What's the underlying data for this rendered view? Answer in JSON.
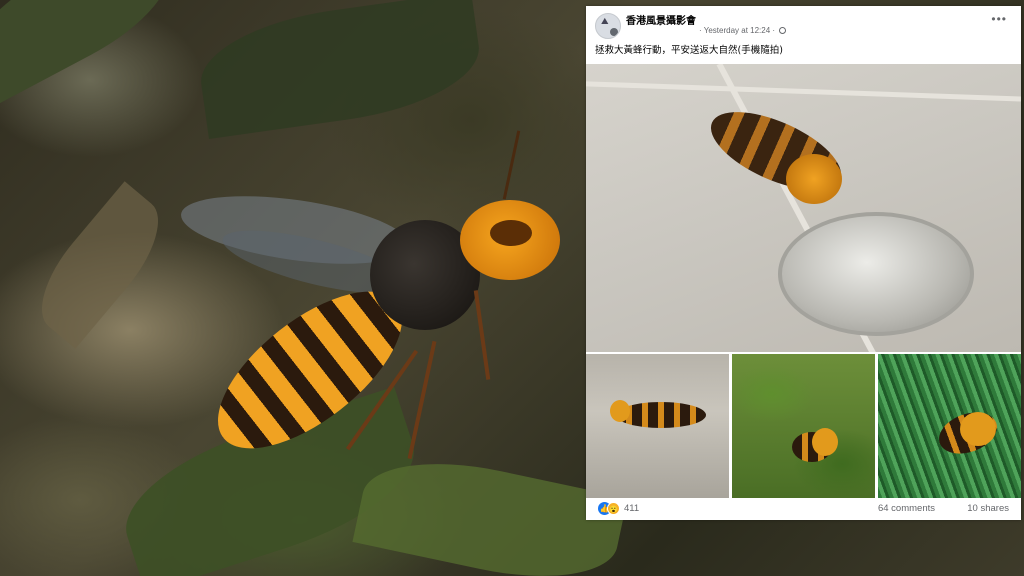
{
  "post": {
    "page_name": "香港風景攝影會",
    "timestamp": "Yesterday at 12:24",
    "separator": "·",
    "more_icon": "•••",
    "caption": "拯救大黃蜂行動，平安送返大自然(手機隨拍)",
    "reactions": {
      "like_icon": "👍",
      "wow_icon": "😮",
      "count": "411"
    },
    "comments": "64 comments",
    "shares": "10 shares"
  },
  "icons": {
    "avatar": "page-avatar",
    "privacy": "globe-icon",
    "more": "more-options-icon"
  },
  "colors": {
    "brand_blue": "#1877f2",
    "wow_yellow": "#f7b125",
    "secondary_text": "#65676b",
    "hornet_orange": "#f0a222"
  }
}
